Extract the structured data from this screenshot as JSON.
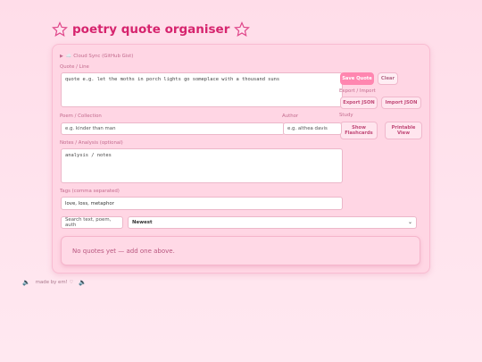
{
  "title": "poetry quote organiser",
  "colors": {
    "accent": "#d6246e",
    "primary_button": "#ff86b0",
    "card": "#ffd6e4"
  },
  "cloud_sync": {
    "label": "☁️ Cloud Sync (GitHub Gist)",
    "icon": "triangle-right-icon"
  },
  "quote": {
    "label": "Quote / Line",
    "placeholder": "quote e.g. let the moths in porch lights go someplace with a thousand suns"
  },
  "actions": {
    "save": "Save Quote",
    "clear": "Clear",
    "export_import_label": "Export / Import",
    "export": "Export JSON",
    "import": "Import JSON",
    "study_label": "Study",
    "flashcards": "Show Flashcards",
    "printable": "Printable View"
  },
  "poem": {
    "label": "Poem / Collection",
    "placeholder": "e.g. kinder than man"
  },
  "author": {
    "label": "Author",
    "placeholder": "e.g. althea davis"
  },
  "notes": {
    "label": "Notes / Analysis (optional)",
    "placeholder": "analysis / notes"
  },
  "tags": {
    "label": "Tags (comma separated)",
    "value": "love, loss, metaphor"
  },
  "search": {
    "placeholder": "Search text, poem, auth"
  },
  "sort": {
    "selected": "Newest"
  },
  "empty_state": "No quotes yet — add one above.",
  "footer": {
    "text": "made by em! ♡",
    "icon": "speaker-icon"
  }
}
